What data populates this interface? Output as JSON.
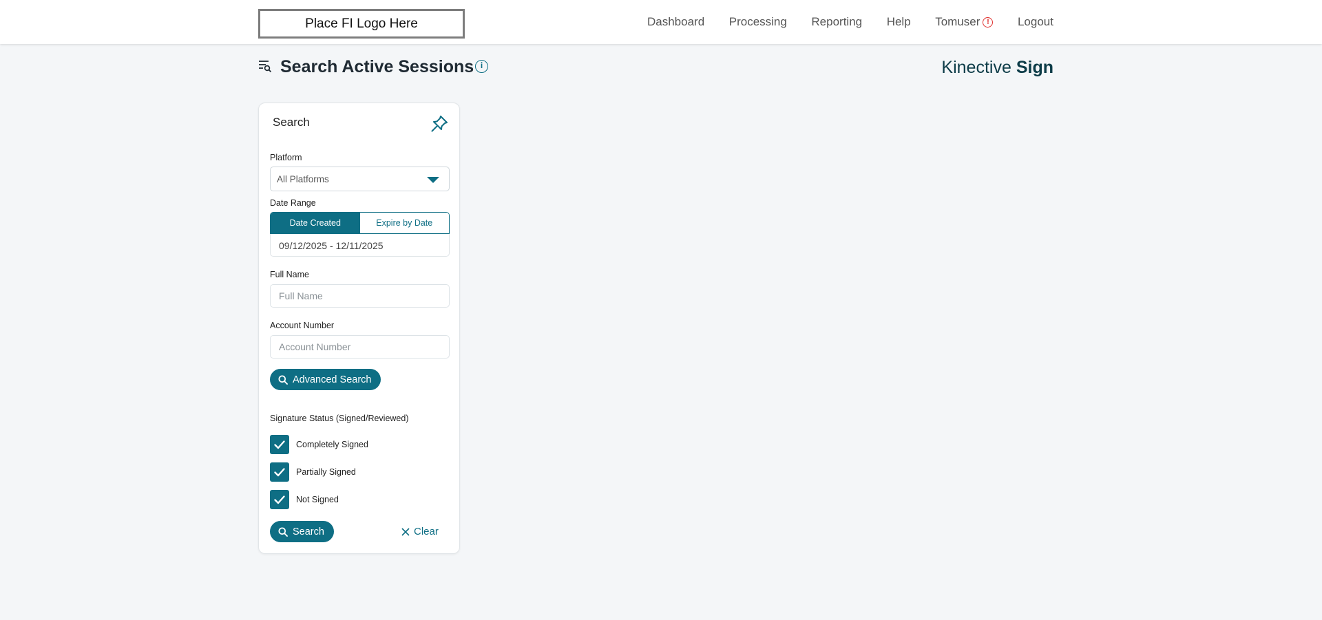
{
  "header": {
    "logo_text": "Place FI Logo Here",
    "nav": [
      "Dashboard",
      "Processing",
      "Reporting",
      "Help",
      "Tomuser",
      "Logout"
    ],
    "user_alert_icon": "exclamation-circle-icon"
  },
  "page": {
    "title": "Search Active Sessions",
    "brand_light": "Kinective",
    "brand_bold": "Sign"
  },
  "search": {
    "title": "Search",
    "platform_label": "Platform",
    "platform_value": "All Platforms",
    "date_range_label": "Date Range",
    "date_tabs": [
      "Date Created",
      "Expire by Date"
    ],
    "date_range_value": "09/12/2025 - 12/11/2025",
    "full_name_label": "Full Name",
    "full_name_placeholder": "Full Name",
    "account_number_label": "Account Number",
    "account_number_placeholder": "Account Number",
    "advanced_search_label": "Advanced Search",
    "signature_status_label": "Signature Status (Signed/Reviewed)",
    "statuses": [
      "Completely Signed",
      "Partially Signed",
      "Not Signed"
    ],
    "search_button": "Search",
    "clear_button": "Clear"
  },
  "colors": {
    "accent": "#0e6e84",
    "alert": "#e0312f",
    "background": "#f4f6f8"
  }
}
